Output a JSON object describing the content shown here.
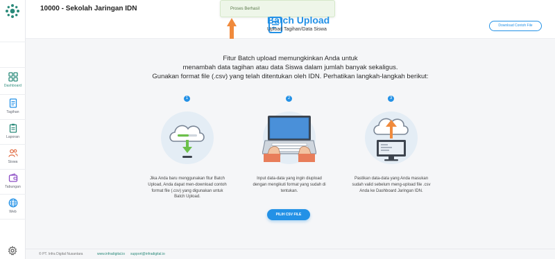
{
  "header": {
    "school_name": "10000 - Sekolah Jaringan IDN"
  },
  "toast": {
    "message": "Proses Berhasil"
  },
  "page": {
    "title": "Batch Upload",
    "subtitle": "Upload Tagihan/Data Siswa",
    "download_button": "Download Contoh File"
  },
  "intro": {
    "line1": "Fitur Batch upload memungkinkan Anda untuk",
    "line2": "menambah data tagihan atau data Siswa dalam jumlah banyak sekaligus.",
    "line3": "Gunakan format file (.csv) yang telah ditentukan oleh IDN. Perhatikan langkah-langkah berikut:"
  },
  "sidebar": {
    "items": [
      {
        "label": "Dashboard",
        "icon": "dashboard-icon",
        "active": true
      },
      {
        "label": "Tagihan",
        "icon": "invoice-icon"
      },
      {
        "label": "Laporan",
        "icon": "report-icon"
      },
      {
        "label": "Siswa",
        "icon": "students-icon"
      },
      {
        "label": "Tabungan",
        "icon": "wallet-icon"
      },
      {
        "label": "Web",
        "icon": "globe-icon"
      }
    ],
    "settings_icon": "gear-icon"
  },
  "steps": [
    {
      "number": "1",
      "desc": [
        "Jika Anda baru menggunakan fitur Batch",
        "Upload, Anda dapat men-download contoh",
        "format file (.csv) yang digunakan untuk",
        "Batch Upload."
      ]
    },
    {
      "number": "2",
      "desc": [
        "Input data-data yang ingin diupload",
        "dengan mengikuti format yang sudah di",
        "tentukan."
      ]
    },
    {
      "number": "3",
      "desc": [
        "Pastikan data-data yang Anda masukan",
        "sudah valid sebelum meng-upload file .csv",
        "Anda ke Dashboard Jaringan IDN."
      ]
    }
  ],
  "actions": {
    "pick_csv": "PILIH CSV FILE"
  },
  "footer": {
    "copyright": "© PT. Infra Digital Nusantara",
    "website": "www.infradigital.io",
    "email": "support@infradigital.io"
  },
  "colors": {
    "accent": "#2391e6",
    "brand": "#2a8a7a",
    "arrow": "#f08a3c",
    "download_arrow": "#6cc04a",
    "toast_bg": "#eef6e9"
  }
}
